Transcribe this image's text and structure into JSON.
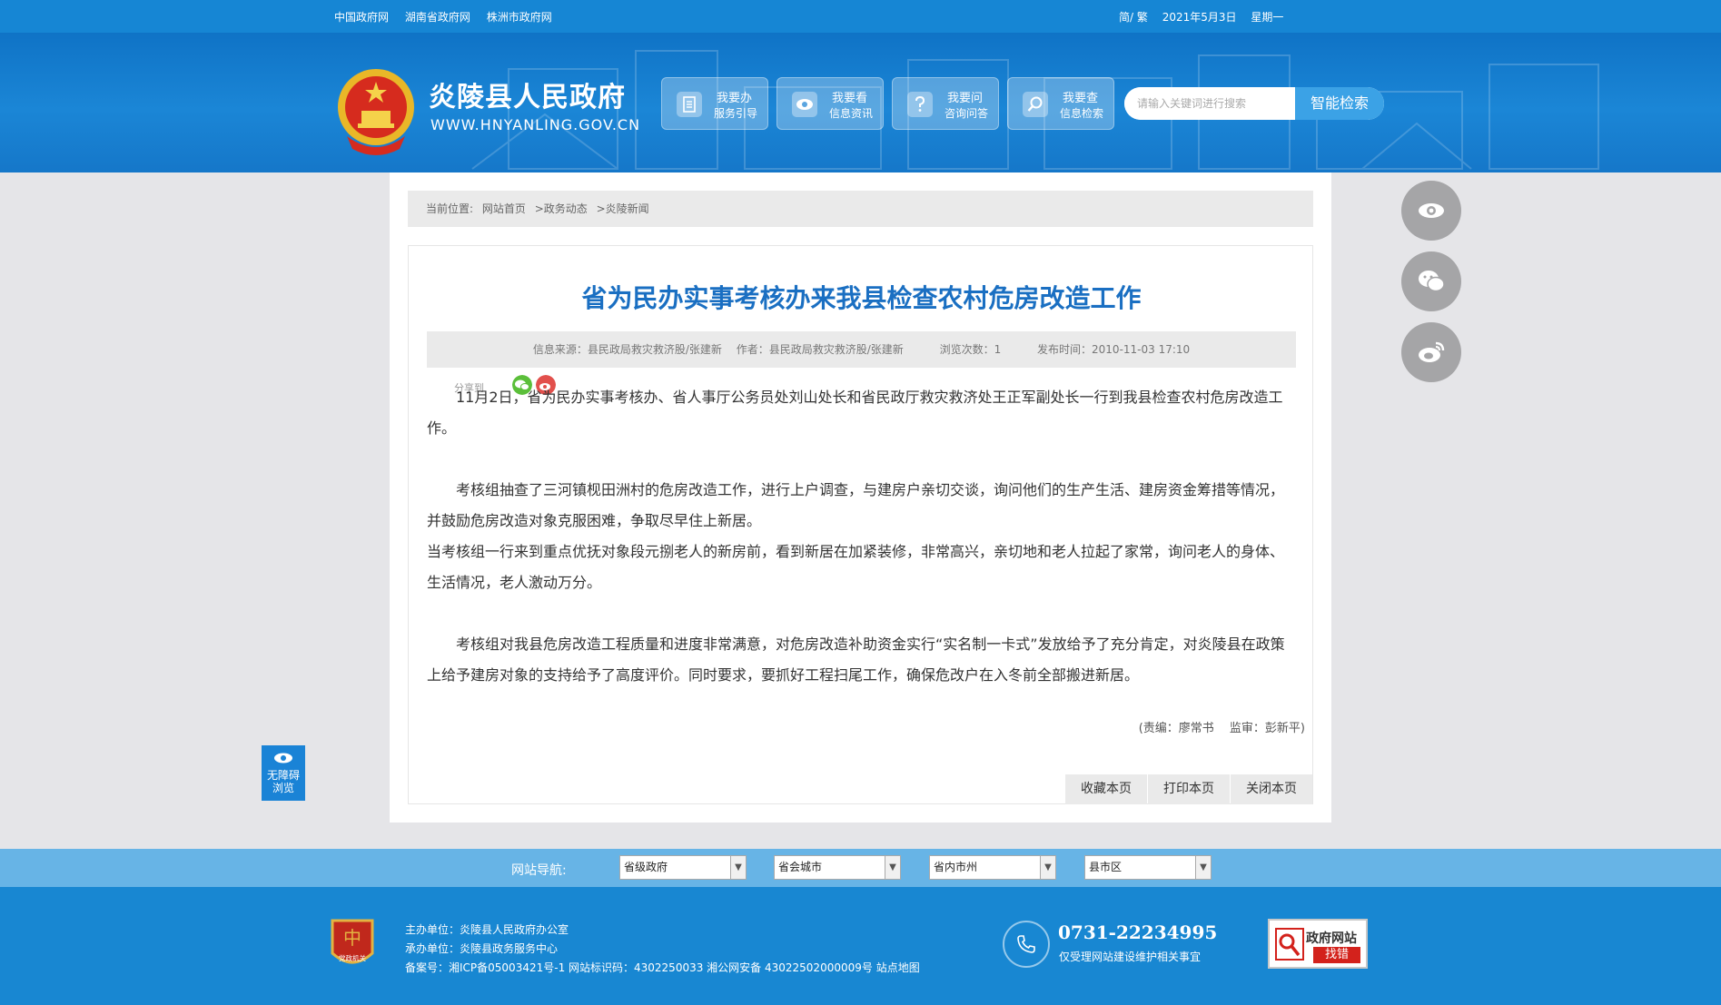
{
  "topbar": {
    "links": [
      "中国政府网",
      "湖南省政府网",
      "株洲市政府网"
    ],
    "lang": "简/ 繁",
    "date": "2021年5月3日",
    "weekday": "星期一"
  },
  "header": {
    "site_name": "炎陵县人民政府",
    "site_url": "WWW.HNYANLING.GOV.CN",
    "quick_buttons": [
      {
        "line1": "我要办",
        "line2": "服务引导",
        "icon": "document-icon"
      },
      {
        "line1": "我要看",
        "line2": "信息资讯",
        "icon": "eye-icon"
      },
      {
        "line1": "我要问",
        "line2": "咨询问答",
        "icon": "question-icon"
      },
      {
        "line1": "我要查",
        "line2": "信息检索",
        "icon": "search-icon"
      }
    ],
    "search": {
      "placeholder": "请输入关键词进行搜索",
      "button": "智能检索"
    }
  },
  "breadcrumb": {
    "prefix": "当前位置:",
    "items": [
      "网站首页",
      ">政务动态",
      ">炎陵新闻"
    ]
  },
  "article": {
    "title": "省为民办实事考核办来我县检查农村危房改造工作",
    "meta": {
      "source": "信息来源：县民政局救灾救济股/张建新",
      "author": "作者：县民政局救灾救济股/张建新",
      "views": "浏览次数：1",
      "published": "发布时间：2010-11-03 17:10"
    },
    "share_label": "分享到",
    "paragraphs": [
      "11月2日，省为民办实事考核办、省人事厅公务员处刘山处长和省民政厅救灾救济处王正军副处长一行到我县检查农村危房改造工作。",
      "考核组抽查了三河镇枧田洲村的危房改造工作，进行上户调查，与建房户亲切交谈，询问他们的生产生活、建房资金筹措等情况，并鼓励危房改造对象克服困难，争取尽早住上新居。",
      "当考核组一行来到重点优抚对象段元捌老人的新房前，看到新居在加紧装修，非常高兴，亲切地和老人拉起了家常，询问老人的身体、生活情况，老人激动万分。",
      "考核组对我县危房改造工程质量和进度非常满意，对危房改造补助资金实行“实名制一卡式”发放给予了充分肯定，对炎陵县在政策上给予建房对象的支持给予了高度评价。同时要求，要抓好工程扫尾工作，确保危改户在入冬前全部搬进新居。"
    ],
    "editor": "(责编：廖常书　 监审：彭新平)",
    "actions": [
      "收藏本页",
      "打印本页",
      "关闭本页"
    ]
  },
  "floating_buttons": [
    "eye-icon",
    "wechat-icon",
    "weibo-icon"
  ],
  "accessibility": {
    "line1": "无障碍",
    "line2": "浏览"
  },
  "site_nav": {
    "label": "网站导航:",
    "selects": [
      "省级政府",
      "省会城市",
      "省内市州",
      "县市区"
    ]
  },
  "footer": {
    "host": "主办单位：炎陵县人民政府办公室",
    "organizer": "承办单位：炎陵县政务服务中心",
    "record": "备案号：湘ICP备05003421号-1 网站标识码：4302250033 湘公网安备 43022502000009号 站点地图",
    "badge_text": "党政机关",
    "phone": "0731-22234995",
    "phone_note": "仅受理网站建设维护相关事宜",
    "error_box": {
      "line1": "政府网站",
      "line2": "找错"
    }
  },
  "colors": {
    "brand_blue": "#1686d4",
    "title_blue": "#1a6fc2",
    "panel_bg": "#ffffff",
    "page_bg": "#e5e5e8"
  }
}
